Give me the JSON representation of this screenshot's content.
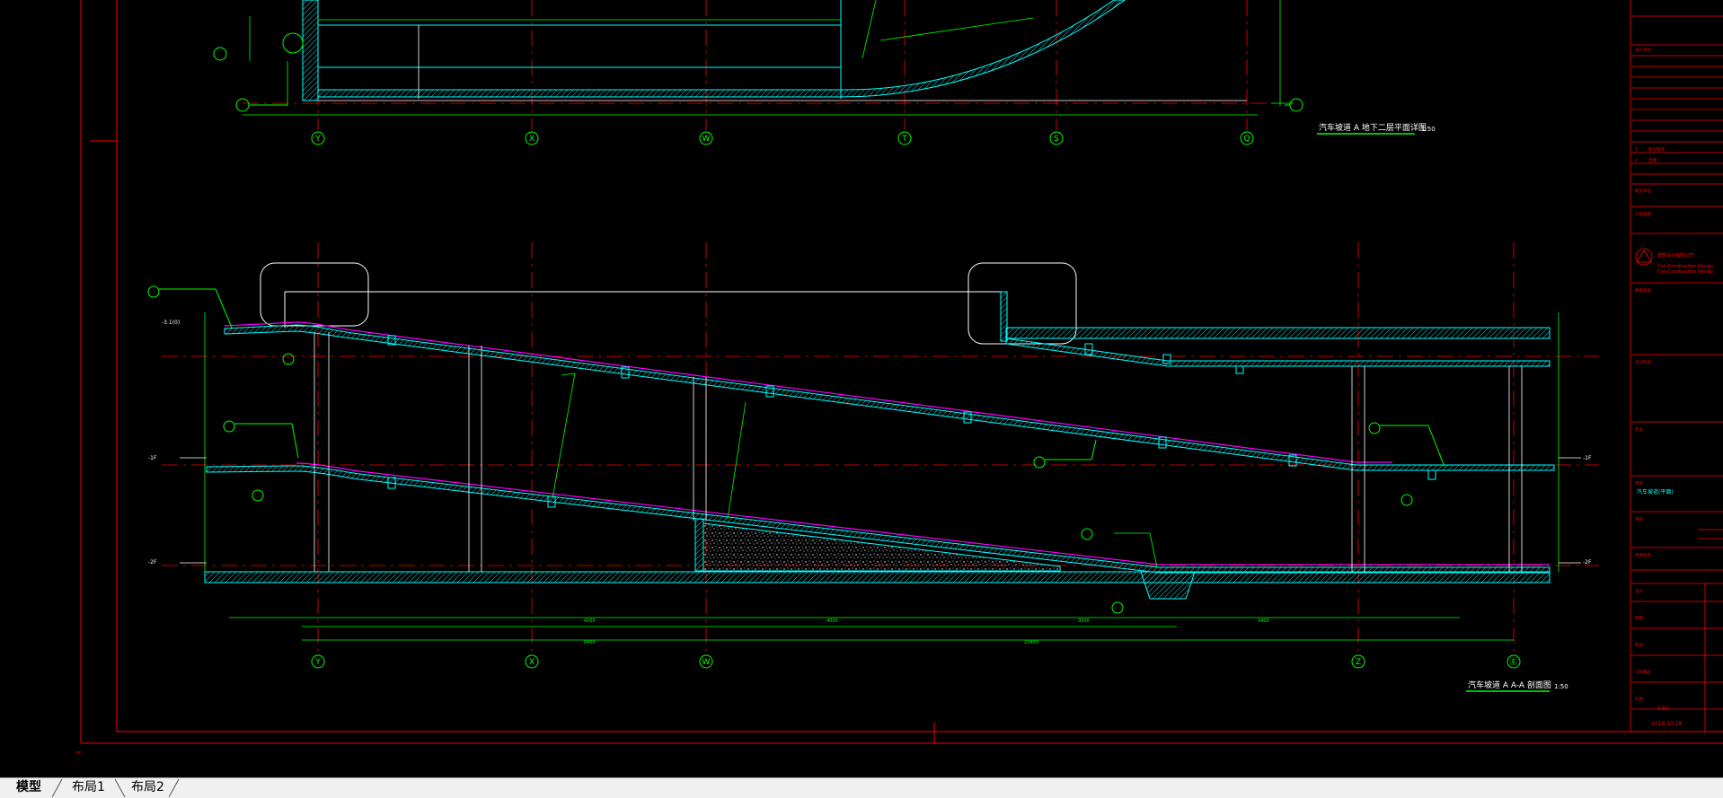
{
  "plan_title": "汽车坡道 A 地下二层平面详图",
  "plan_scale": "1:50",
  "section_title": "汽车坡道 A A-A 剖面图",
  "section_scale": "1:50",
  "axes_top": [
    "Y",
    "X",
    "W",
    "T",
    "S",
    "Q"
  ],
  "axes_bottom": [
    "Y",
    "X",
    "W",
    "Z",
    "Ⓔ"
  ],
  "callouts": [
    "①",
    "②",
    "③",
    "②",
    "③",
    "②",
    "②",
    "②",
    "③"
  ],
  "levels": {
    "top_left": "-3.1(0)",
    "mid_left": "-1F",
    "bottom_left": "-2F",
    "right_upper": "-1F",
    "right_lower": "-2F"
  },
  "title_block": {
    "sheet_no": "Y-50",
    "date": "2019.10.28",
    "company": "Con-Construction Design",
    "project": "汽车坡道(平面)"
  },
  "tabs": [
    {
      "label": "模型",
      "active": true
    },
    {
      "label": "布局1",
      "active": false
    },
    {
      "label": "布局2",
      "active": false
    }
  ],
  "colors": {
    "background": "#000000",
    "frame": "#ff0000",
    "axis": "#ff0000",
    "dimension": "#00ff00",
    "structure": "#00ffff",
    "finish": "#ff00ff",
    "annotation": "#ffffff",
    "title_block_text": "#ff0000"
  }
}
